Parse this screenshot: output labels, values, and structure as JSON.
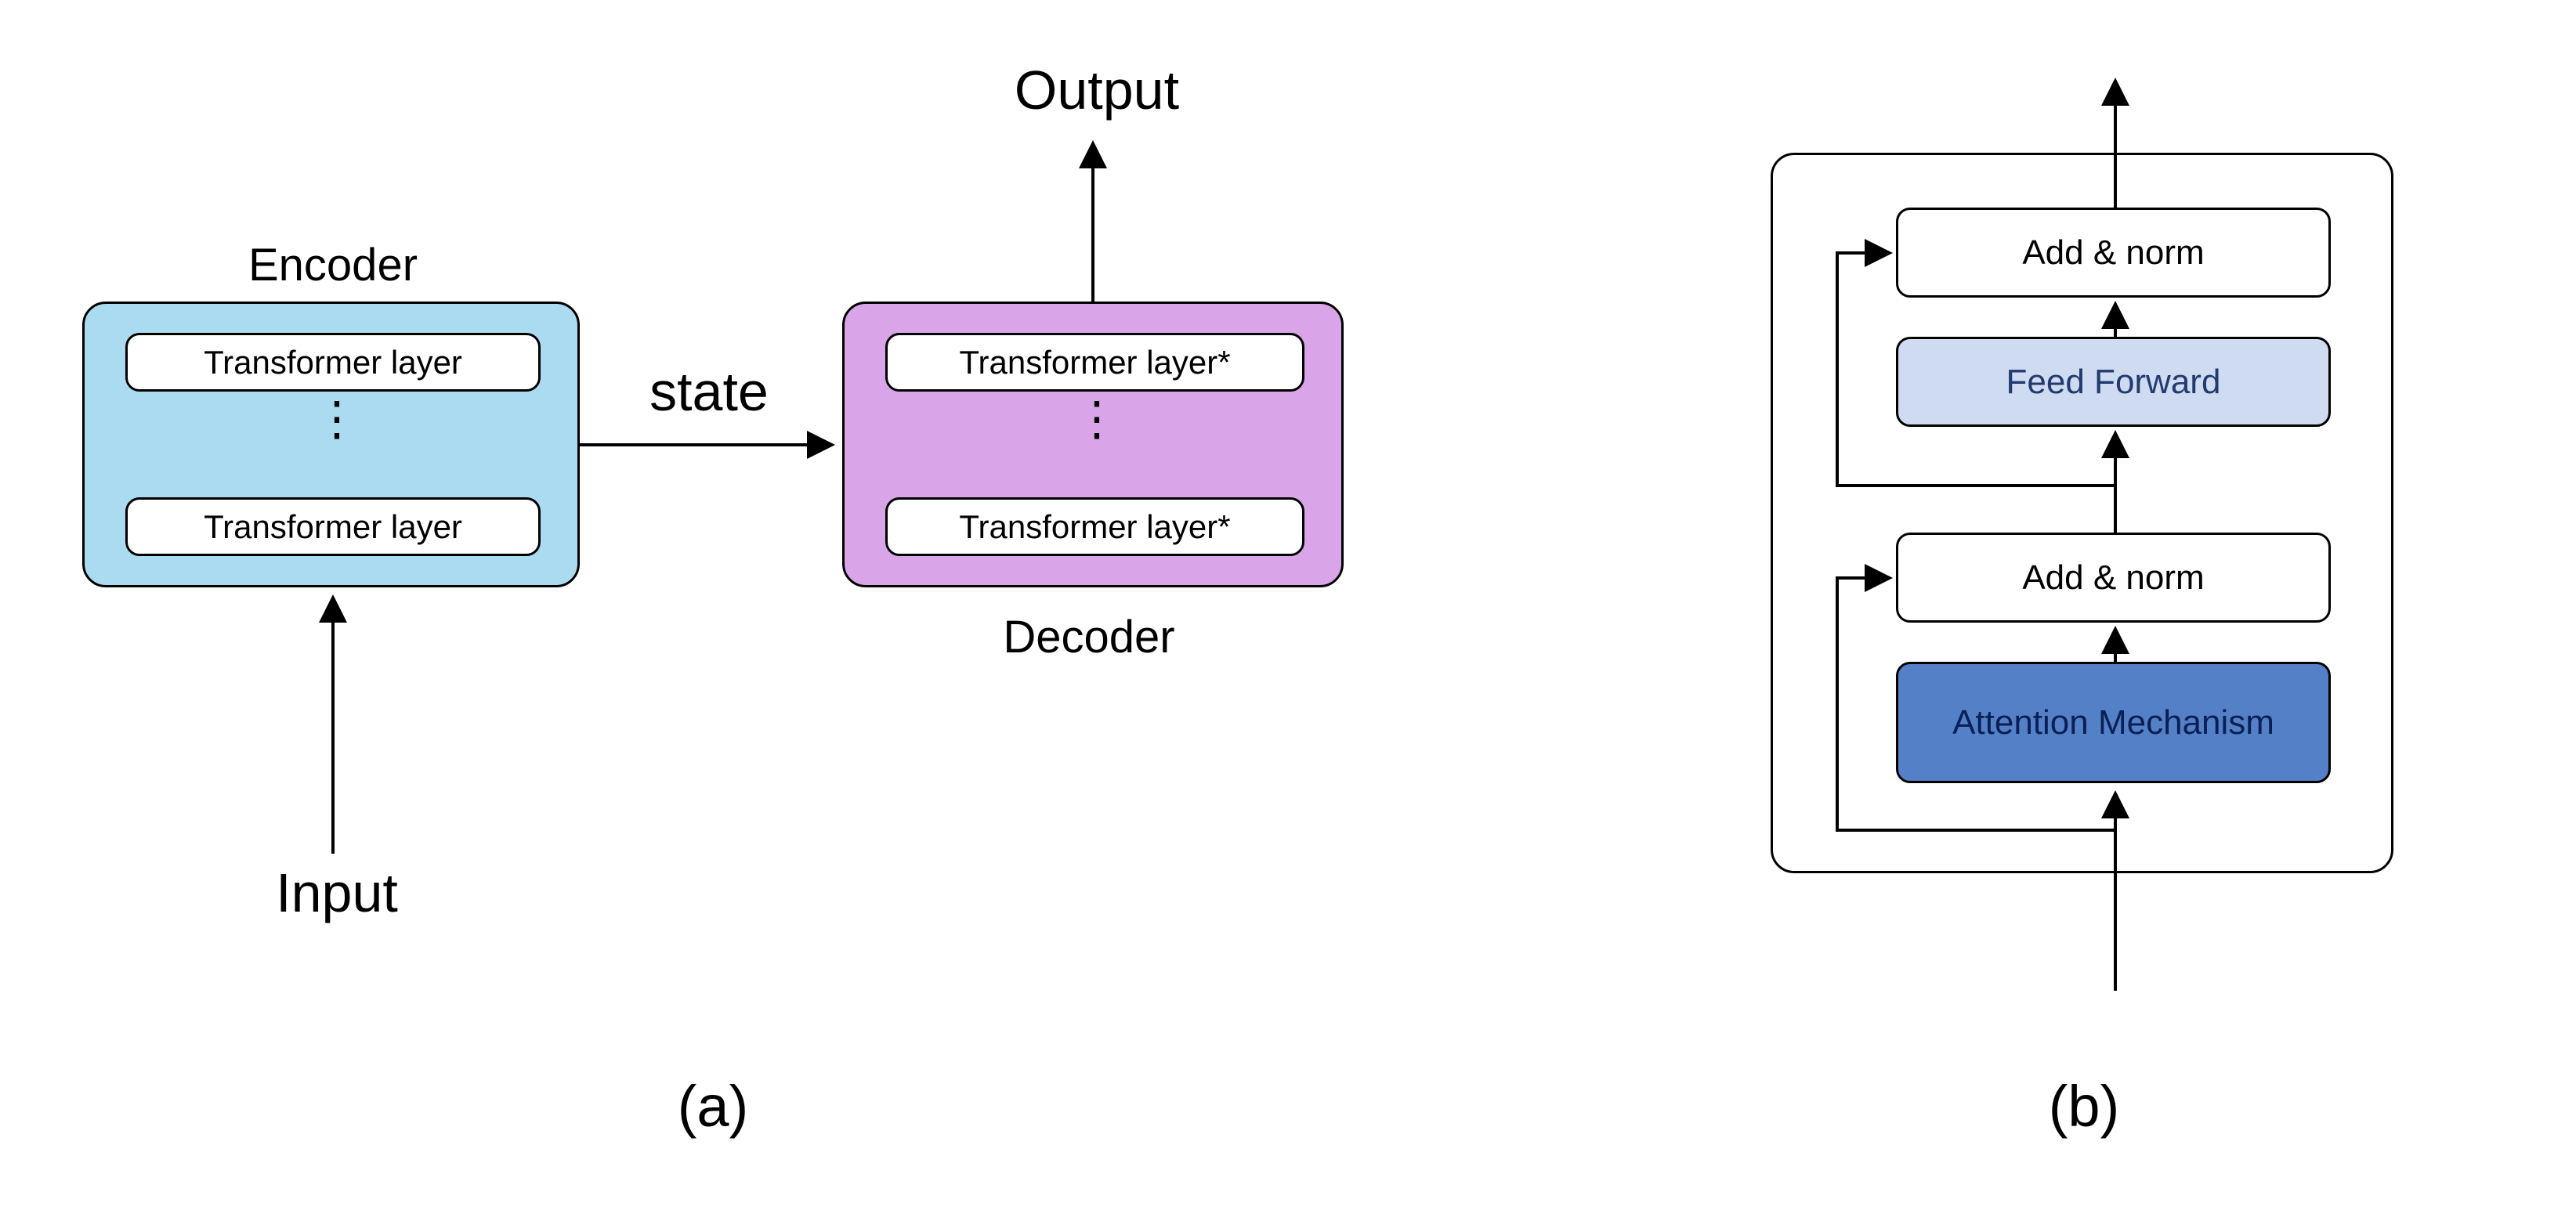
{
  "panelA": {
    "encoderLabel": "Encoder",
    "decoderLabel": "Decoder",
    "encoderLayerTop": "Transformer layer",
    "encoderLayerBottom": "Transformer layer",
    "decoderLayerTop": "Transformer layer*",
    "decoderLayerBottom": "Transformer layer*",
    "inputLabel": "Input",
    "outputLabel": "Output",
    "stateLabel": "state",
    "caption": "(a)"
  },
  "panelB": {
    "addNorm1": "Add & norm",
    "addNorm2": "Add & norm",
    "feedForward": "Feed Forward",
    "attention": "Attention Mechanism",
    "caption": "(b)"
  }
}
